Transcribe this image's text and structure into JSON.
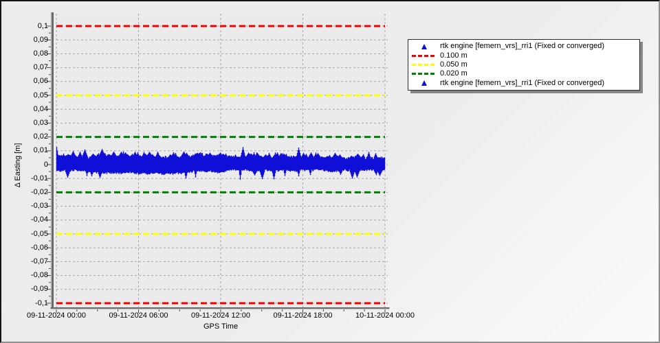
{
  "page": {
    "background_top_left": "#ececec",
    "background_bottom_right": "#fbfbfb",
    "border_dark": "#141414",
    "border_light": "#8f8f8f"
  },
  "palette": {
    "plot_background": "#ebebeb",
    "grid_color": "#a6a6a6",
    "axis_line_dark": "#6a6a6a",
    "axis_line_light": "#c8c8c8",
    "tick_color": "#4a4a4a",
    "series_blue": "#0f0fd7",
    "threshold_red": "#f20000",
    "threshold_yellow": "#ffff00",
    "threshold_green": "#008000",
    "legend_background": "#ffffff",
    "legend_border": "#2b2b2b"
  },
  "chart_data": {
    "type": "scatter",
    "title": "",
    "xlabel": "GPS Time",
    "ylabel": "Δ Easting [m]",
    "x_tick_labels": [
      "09-11-2024 00:00",
      "09-11-2024 06:00",
      "09-11-2024 12:00",
      "09-11-2024 18:00",
      "10-11-2024 00:00"
    ],
    "x_major_interval_hours": 6,
    "x_minor_interval_hours": 1.5,
    "ylim": [
      -0.1,
      0.1
    ],
    "y_tick_step": 0.01,
    "y_minor_step": 0.005,
    "y_tick_labels": [
      "0,1",
      "0,09",
      "0,08",
      "0,07",
      "0,06",
      "0,05",
      "0,04",
      "0,03",
      "0,02",
      "0,01",
      "0",
      "-0,01",
      "-0,02",
      "-0,03",
      "-0,04",
      "-0,05",
      "-0,06",
      "-0,07",
      "-0,08",
      "-0,09",
      "-0,1"
    ],
    "grid": true,
    "grid_style": "dashed",
    "legend_position": "top-right-outside",
    "series": [
      {
        "name": "rtk engine [femern_vrs]_rri1 (Fixed or converged)",
        "type": "scatter",
        "marker": "triangle",
        "color": "#0f0fd7",
        "description": "dense noise band of easting residuals over 24 h",
        "center": 0.0,
        "typical_range": [
          -0.007,
          0.009
        ],
        "extremes": [
          -0.013,
          0.014
        ],
        "seed": 20241109
      },
      {
        "name": "0.100 m",
        "type": "threshold",
        "values": [
          0.1,
          -0.1
        ],
        "color": "#f20000",
        "style": "dashed"
      },
      {
        "name": "0.050 m",
        "type": "threshold",
        "values": [
          0.05,
          -0.05
        ],
        "color": "#ffff00",
        "style": "dashed"
      },
      {
        "name": "0.020 m",
        "type": "threshold",
        "values": [
          0.02,
          -0.02
        ],
        "color": "#008000",
        "style": "dashed"
      },
      {
        "name": "rtk engine [femern_vrs]_rri1 (Fixed or converged)",
        "type": "scatter",
        "marker": "triangle",
        "color": "#0f0fd7"
      }
    ],
    "legend": {
      "entries": [
        {
          "symbol": "triangle",
          "color": "#0f0fd7",
          "label": "rtk engine [femern_vrs]_rri1 (Fixed or converged)"
        },
        {
          "symbol": "dashes",
          "color": "#f20000",
          "label": "0.100 m"
        },
        {
          "symbol": "dashes",
          "color": "#ffff00",
          "label": "0.050 m"
        },
        {
          "symbol": "dashes",
          "color": "#008000",
          "label": "0.020 m"
        },
        {
          "symbol": "triangle",
          "color": "#0f0fd7",
          "label": "rtk engine [femern_vrs]_rri1 (Fixed or converged)"
        }
      ]
    }
  }
}
